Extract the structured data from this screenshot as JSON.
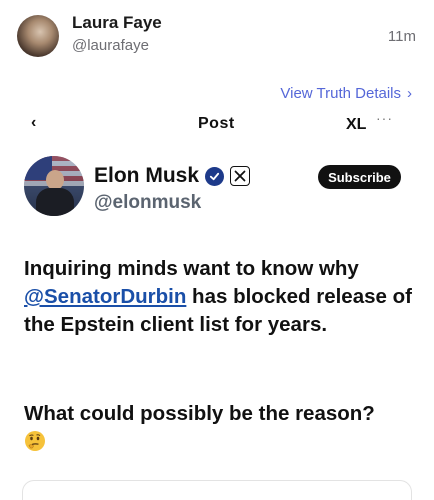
{
  "post": {
    "author_name": "Laura Faye",
    "author_handle": "@laurafaye",
    "timestamp": "11m",
    "view_details_label": "View Truth Details",
    "view_details_chevron": "›"
  },
  "embed": {
    "clipped_back": "‹",
    "clipped_title": "Post",
    "clipped_xl": "XL",
    "clipped_dots": "···",
    "author_name": "Elon Musk",
    "author_handle": "@elonmusk",
    "subscribe_label": "Subscribe",
    "text_before_mention": "Inquiring minds want to know why ",
    "mention": "@SenatorDurbin",
    "text_after_mention": " has blocked release of the Epstein client list for years.",
    "question": "What could possibly be the reason?",
    "emoji": "thinking-face"
  },
  "colors": {
    "link": "#5567d8",
    "mention": "#1a4fa8",
    "verified": "#1d3a8a"
  }
}
